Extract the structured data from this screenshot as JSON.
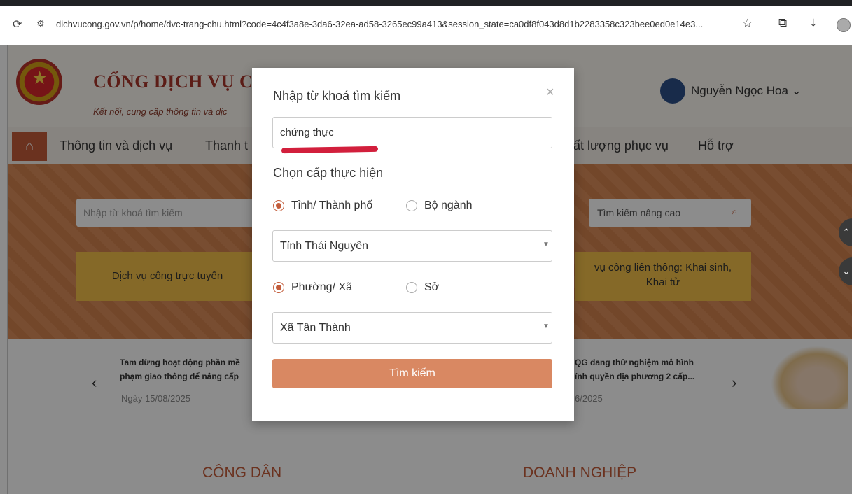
{
  "browser": {
    "url": "dichvucong.gov.vn/p/home/dvc-trang-chu.html?code=4c4f3a8e-3da6-32ea-ad58-3265ec99a413&session_state=ca0df8f043d8d1b2283358c323bee0ed0e14e3..."
  },
  "header": {
    "title": "CỔNG DỊCH VỤ CÔ",
    "subtitle": "Kết nối, cung cấp thông tin và dịc",
    "user": "Nguyễn Ngọc Hoa"
  },
  "nav": {
    "items": [
      "Thông tin và dịch vụ",
      "Thanh t",
      "ất lượng phục vụ",
      "Hỗ trợ"
    ]
  },
  "hero": {
    "search_placeholder": "Nhập từ khoá tìm kiếm",
    "advanced_search": "Tìm kiếm nâng cao",
    "card_left": "Dịch vụ công trực tuyến",
    "card_right_line1": "vụ công liên thông: Khai sinh,",
    "card_right_line2": "Khai tử"
  },
  "news": {
    "left_line1": "Tam dừng hoạt động phần mề",
    "left_line2": "phạm giao thông để nâng cấp",
    "left_date": "Ngày 15/08/2025",
    "right_line1": "QG đang thử nghiệm mô hình",
    "right_line2": "ính quyền địa phương 2 cấp...",
    "right_date": "6/2025"
  },
  "sections": {
    "citizen": "CÔNG DÂN",
    "business": "DOANH NGHIỆP"
  },
  "modal": {
    "title": "Nhập từ khoá tìm kiếm",
    "keyword": "chứng thực",
    "level_title": "Chọn cấp thực hiện",
    "radio_province": "Tỉnh/ Thành phố",
    "radio_ministry": "Bộ ngành",
    "province_value": "Tỉnh Thái Nguyên",
    "radio_ward": "Phường/ Xã",
    "radio_department": "Sở",
    "ward_value": "Xã Tân Thành",
    "search_button": "Tìm kiếm"
  },
  "colors": {
    "accent": "#c35c3a",
    "button": "#d98862",
    "card": "#f2c04a"
  }
}
